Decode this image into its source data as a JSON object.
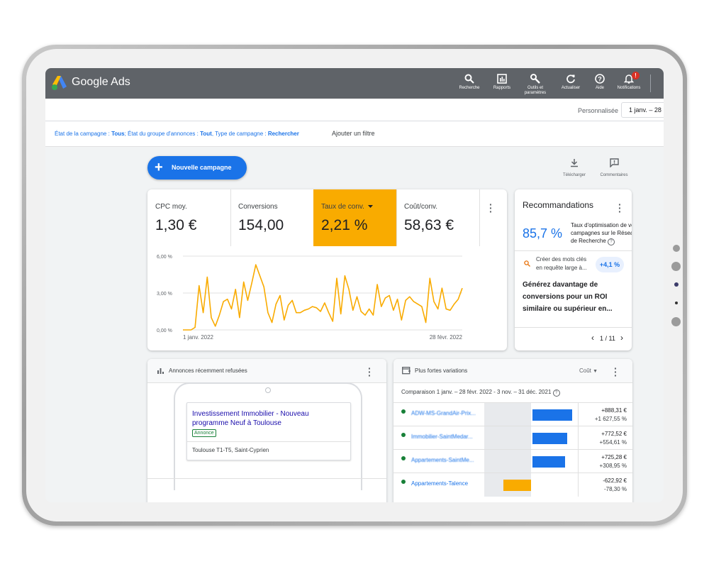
{
  "app": {
    "brand": "Google Ads",
    "colors": {
      "header": "#5f6368",
      "primary": "#1a73e8",
      "accent": "#f9ab00",
      "positive": "#188038"
    }
  },
  "topbar": {
    "items": [
      {
        "label": "Recherche",
        "icon": "search-icon"
      },
      {
        "label": "Rapports",
        "icon": "reports-icon"
      },
      {
        "label": "Outils et paramètres",
        "icon": "tools-icon"
      },
      {
        "label": "Actualiser",
        "icon": "refresh-icon"
      },
      {
        "label": "Aide",
        "icon": "help-icon"
      },
      {
        "label": "Notifications",
        "icon": "bell-icon",
        "badge": "!"
      }
    ]
  },
  "datebar": {
    "label": "Personnalisée",
    "range": "1 janv. – 28"
  },
  "filters": {
    "parts": [
      {
        "text": "État de la campagne : ",
        "bold": "Tous"
      },
      {
        "text": "; État du groupe d'annonces : ",
        "bold": "Tout"
      },
      {
        "text": ", Type de campagne : ",
        "bold": "Rechercher"
      }
    ],
    "add_filter": "Ajouter un filtre"
  },
  "actions": {
    "new_campaign": "Nouvelle campagne",
    "download": "Télécharger",
    "feedback": "Commentaires"
  },
  "metrics": [
    {
      "label": "CPC moy.",
      "value": "1,30 €"
    },
    {
      "label": "Conversions",
      "value": "154,00"
    },
    {
      "label": "Taux de conv.",
      "value": "2,21 %",
      "active": true
    },
    {
      "label": "Coût/conv.",
      "value": "58,63 €"
    }
  ],
  "chart_data": {
    "type": "line",
    "y_ticks": [
      "6,00 %",
      "3,00 %",
      "0,00 %"
    ],
    "x_labels": [
      "1 janv. 2022",
      "28 févr. 2022"
    ],
    "ylim": [
      0,
      6
    ],
    "series": [
      {
        "color": "#f9ab00",
        "values": [
          0,
          0,
          0,
          0.2,
          3.6,
          1.4,
          4.3,
          1.0,
          0.3,
          1.2,
          2.3,
          2.5,
          1.7,
          3.3,
          1.0,
          3.9,
          2.4,
          3.8,
          5.3,
          4.4,
          3.5,
          1.4,
          0.6,
          2.1,
          2.8,
          0.8,
          2.0,
          2.4,
          1.4,
          1.4,
          1.6,
          1.7,
          1.9,
          1.8,
          1.5,
          2.2,
          1.4,
          0.7,
          4.2,
          1.3,
          4.4,
          3.3,
          1.6,
          2.7,
          1.5,
          1.2,
          1.7,
          1.2,
          3.7,
          1.9,
          2.6,
          2.8,
          1.6,
          2.5,
          0.8,
          2.4,
          2.7,
          2.3,
          2.1,
          1.9,
          0.6,
          4.2,
          2.3,
          1.7,
          3.4,
          1.7,
          1.6,
          2.1,
          2.5,
          3.4
        ]
      }
    ]
  },
  "recommendations": {
    "title": "Recommandations",
    "score": "85,7 %",
    "score_desc": "Taux d'optimisation de vos campagnes sur le Réseau de Recherche",
    "suggestion": "Créer des mots clés en requête large à...",
    "badge": "+4,1 %",
    "body": "Générez davantage de conversions pour un ROI similaire ou supérieur en...",
    "pagination": "1 / 11"
  },
  "refused_ads": {
    "title": "Annonces récemment refusées",
    "ad_title": "Investissement Immobilier - Nouveau programme Neuf à Toulouse",
    "ad_tag": "Annonce",
    "ad_location": "Toulouse T1-T5, Saint-Cyprien"
  },
  "variations": {
    "title": "Plus fortes variations",
    "sort": "Coût",
    "comparison": "Comparaison 1 janv. – 28 févr. 2022 - 3 nov. – 31 déc. 2021",
    "rows": [
      {
        "name": "ADW-MS-GrandAir-Prix...",
        "value": "+888,31 €",
        "percent": "+1 627,55 %",
        "change": 888.31
      },
      {
        "name": "Immobilier-SaintMedar...",
        "value": "+772,52 €",
        "percent": "+554,61 %",
        "change": 772.52
      },
      {
        "name": "Appartements-SaintMe...",
        "value": "+725,28 €",
        "percent": "+308,95 %",
        "change": 725.28
      },
      {
        "name": "Appartements-Talence",
        "value": "-622,92 €",
        "percent": "-78,30 %",
        "change": -622.92
      }
    ]
  }
}
